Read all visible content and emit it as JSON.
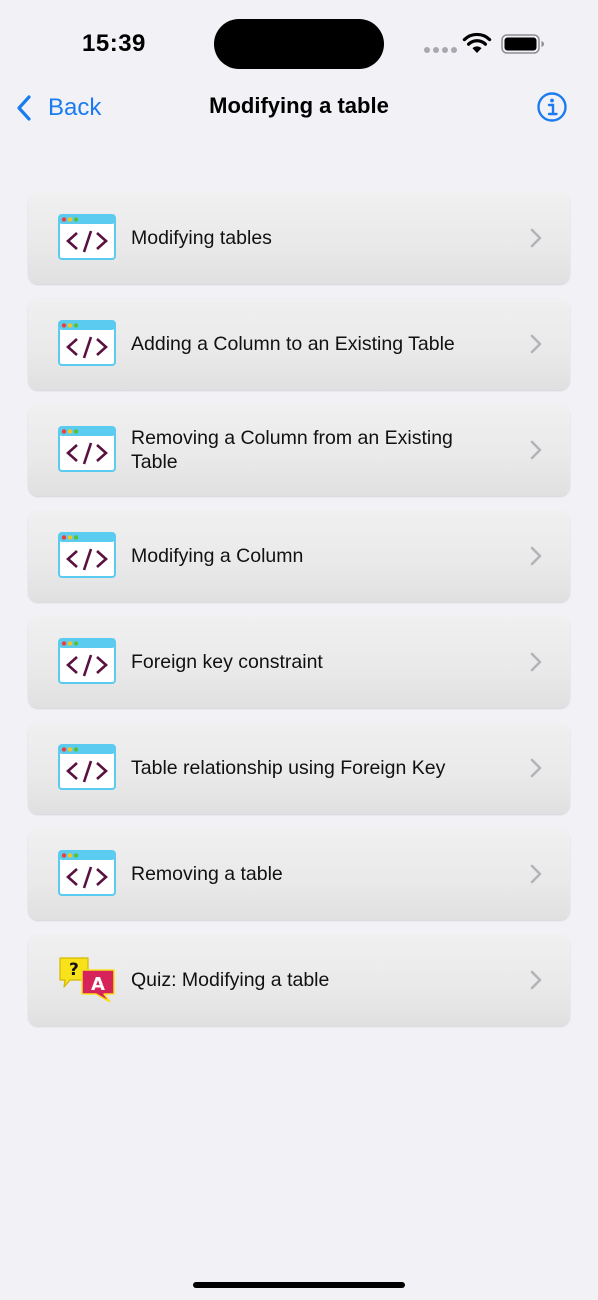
{
  "status_bar": {
    "time": "15:39"
  },
  "nav": {
    "back_label": "Back",
    "title": "Modifying a table"
  },
  "items": [
    {
      "label": "Modifying tables",
      "icon": "code-window-icon"
    },
    {
      "label": "Adding a Column to an Existing Table",
      "icon": "code-window-icon"
    },
    {
      "label": "Removing a Column from an Existing Table",
      "icon": "code-window-icon"
    },
    {
      "label": "Modifying a Column",
      "icon": "code-window-icon"
    },
    {
      "label": "Foreign key constraint",
      "icon": "code-window-icon"
    },
    {
      "label": "Table relationship using Foreign Key",
      "icon": "code-window-icon"
    },
    {
      "label": "Removing a table",
      "icon": "code-window-icon"
    },
    {
      "label": "Quiz: Modifying a table",
      "icon": "quiz-bubbles-icon"
    }
  ],
  "colors": {
    "accent": "#1a7cf0",
    "background": "#f1f1f6",
    "code_icon_bar": "#5ccbf0",
    "code_icon_glyph": "#5a1040",
    "quiz_yellow": "#f7e21b",
    "quiz_pink": "#d6245a"
  }
}
